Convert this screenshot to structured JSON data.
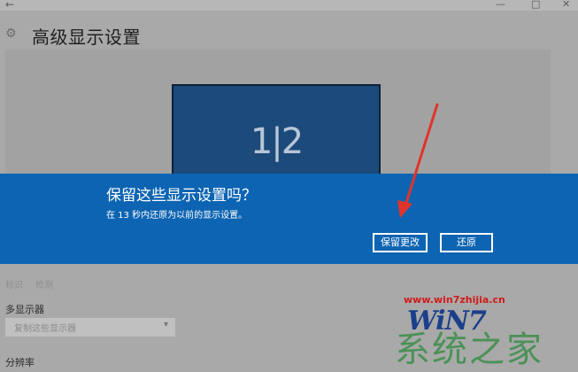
{
  "window": {
    "back_glyph": "←",
    "controls": [
      "—",
      "□",
      "✕"
    ]
  },
  "header": {
    "icon": "gear-icon",
    "title": "高级显示设置"
  },
  "preview": {
    "monitor_label": "1|2"
  },
  "dialog": {
    "title": "保留这些显示设置吗？",
    "message": "在 13 秒内还原为以前的显示设置。",
    "keep_button": "保留更改",
    "revert_button": "还原"
  },
  "settings": {
    "identify_link": "标识",
    "detect_link": "检测",
    "multi_display_label": "多显示器",
    "multi_display_value": "复制这些显示器",
    "resolution_label": "分辨率"
  },
  "watermark": {
    "url": "www.win7zhijia.cn",
    "logo": "WiN7",
    "subtitle": "系统之家"
  },
  "colors": {
    "banner": "#0d64b2",
    "monitor": "#1c4a7a",
    "arrow": "#e0342a"
  }
}
